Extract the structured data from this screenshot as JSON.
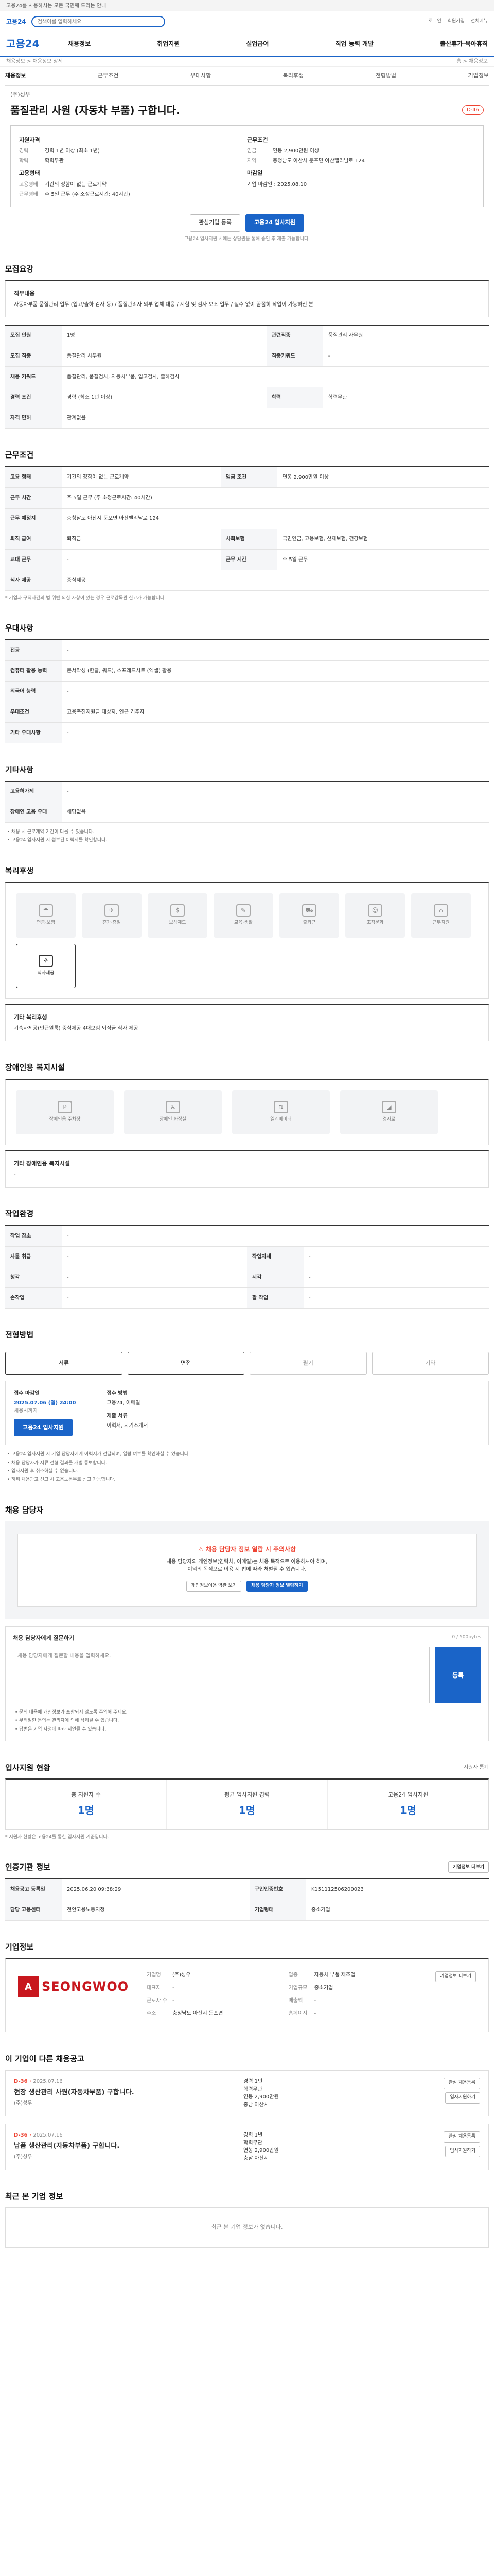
{
  "topbar": {
    "text": "고용24를 사용하시는 모든 국민께 드리는 안내"
  },
  "search": {
    "logo": "고용24",
    "placeholder": "검색어를 입력하세요"
  },
  "top_links": [
    "로그인",
    "회원가입",
    "전체메뉴"
  ],
  "gnb": {
    "brand": "고용24",
    "menu": [
      "채용정보",
      "취업지원",
      "실업급여",
      "직업 능력 개발",
      "출산휴가·육아휴직"
    ]
  },
  "crumb": {
    "left": "채용정보 > 채용정보 상세",
    "right": "홈 > 채용정보"
  },
  "subtabs": [
    "채용정보",
    "근무조건",
    "우대사항",
    "복리후생",
    "전형방법",
    "기업정보"
  ],
  "job": {
    "company": "(주)성우",
    "title": "품질관리 사원 (자동차 부품) 구합니다.",
    "badge": "D-46",
    "qual_title": "지원자격",
    "qual": [
      {
        "k": "경력",
        "v": "경력 1년 이상 (최소 1년)"
      },
      {
        "k": "학력",
        "v": "학력무관"
      }
    ],
    "cond_title": "근무조건",
    "cond": [
      {
        "k": "임금",
        "v": "연봉 2,900만원 이상"
      },
      {
        "k": "지역",
        "v": "충청남도 아산시 둔포면 아산밸리남로 124"
      }
    ],
    "form_title": "고용형태",
    "form": [
      {
        "k": "고용형태",
        "v": "기간의 정함이 없는 근로계약"
      },
      {
        "k": "근무형태",
        "v": "주 5일 근무 (주 소정근로시간: 40시간)"
      }
    ],
    "deadline_title": "마감일",
    "deadline": "기업 마감일 : 2025.08.10"
  },
  "actions": {
    "share": "관심기업 등록",
    "apply": "고용24 입사지원"
  },
  "notice": "고용24 입사지원 시에는 상담원을 통해 승인 후 제출 가능합니다.",
  "sec_job": {
    "title": "모집요강",
    "desc_head": "직무내용",
    "desc": "자동차부품 품질관리 업무 (입고/출하 검사 등) / 품질관리자 외부 업체 대응 / 시험 및 검사 보조 업무 / 실수 없이 꼼꼼히 작업이 가능하신 분",
    "rows": [
      {
        "k": "모집 인원",
        "v": "1명",
        "k2": "관련직종",
        "v2": "품질관리 사무원"
      },
      {
        "k": "모집 직종",
        "v": "품질관리 사무원",
        "k2": "직종키워드",
        "v2": "-"
      },
      {
        "k": "채용 키워드",
        "v": "품질관리, 품질검사, 자동차부품, 입고검사, 출하검사",
        "k2": "",
        "v2": ""
      },
      {
        "k": "경력 조건",
        "v": "경력 (최소 1년 이상)",
        "k2": "학력",
        "v2": "학력무관"
      },
      {
        "k": "자격 면허",
        "v": "관계없음",
        "k2": "",
        "v2": ""
      }
    ]
  },
  "sec_cond": {
    "title": "근무조건",
    "rows": [
      {
        "k": "고용 형태",
        "v": "기간의 정함이 없는 근로계약",
        "k2": "임금 조건",
        "v2": "연봉 2,900만원 이상"
      },
      {
        "k": "근무 시간",
        "v": "주 5일 근무 (주 소정근로시간: 40시간)",
        "k2": "",
        "v2": ""
      },
      {
        "k": "근무 예정지",
        "v": "충청남도 아산시 둔포면 아산밸리남로 124",
        "k2": "",
        "v2": ""
      },
      {
        "k": "퇴직 급여",
        "v": "퇴직금",
        "k2": "사회보험",
        "v2": "국민연금, 고용보험, 산재보험, 건강보험"
      },
      {
        "k": "교대 근무",
        "v": "-",
        "k2": "근무 시간",
        "v2": "주 5일 근무"
      },
      {
        "k": "식사 제공",
        "v": "중식제공",
        "k2": "",
        "v2": ""
      }
    ],
    "note": "* 기업과 구직자간의 법 위반 의심 사항이 있는 경우 근로감독관 신고가 가능합니다."
  },
  "sec_pref": {
    "title": "우대사항",
    "rows": [
      {
        "k": "전공",
        "v": "-"
      },
      {
        "k": "컴퓨터 활용 능력",
        "v": "문서작성 (한글, 워드), 스프레드시트 (엑셀) 활용"
      },
      {
        "k": "외국어 능력",
        "v": "-"
      },
      {
        "k": "우대조건",
        "v": "고용촉진지원금 대상자, 인근 거주자"
      },
      {
        "k": "기타 우대사항",
        "v": "-"
      }
    ]
  },
  "sec_etc": {
    "title": "기타사항",
    "rows": [
      {
        "k": "고용허가제",
        "v": "-"
      },
      {
        "k": "장애인 고용 우대",
        "v": "해당없음"
      }
    ],
    "bullets": [
      "채용 시 근로계약 기간이 다를 수 있습니다.",
      "고용24 입사지원 시 첨부된 이력서를 확인합니다."
    ]
  },
  "sec_welfare": {
    "title": "복리후생",
    "icons": [
      {
        "n": "연금·보험",
        "g": "☂",
        "on": false
      },
      {
        "n": "휴가·휴일",
        "g": "✈",
        "on": false
      },
      {
        "n": "보상제도",
        "g": "$",
        "on": false
      },
      {
        "n": "교육·생활",
        "g": "✎",
        "on": false
      },
      {
        "n": "출퇴근",
        "g": "⛟",
        "on": false
      },
      {
        "n": "조직문화",
        "g": "☺",
        "on": false
      },
      {
        "n": "근무지원",
        "g": "⌂",
        "on": false
      },
      {
        "n": "식사제공",
        "g": "⚘",
        "on": true
      }
    ],
    "detail_head": "기타 복리후생",
    "detail": "기숙사제공(인근원룸) 중식제공 4대보험 퇴직금 식사 제공"
  },
  "sec_disab": {
    "title": "장애인용 복지시설",
    "icons": [
      {
        "n": "장애인용 주차장",
        "g": "P"
      },
      {
        "n": "장애인 화장실",
        "g": "♿"
      },
      {
        "n": "엘리베이터",
        "g": "⇅"
      },
      {
        "n": "경사로",
        "g": "◢"
      }
    ],
    "detail_head": "기타 장애인용 복지시설",
    "detail": "-"
  },
  "sec_env": {
    "title": "작업환경",
    "rows": [
      {
        "k": "작업 장소",
        "v": "-",
        "k2": "",
        "v2": ""
      },
      {
        "k": "사물 취급",
        "v": "-",
        "k2": "작업자세",
        "v2": "-"
      },
      {
        "k": "청각",
        "v": "-",
        "k2": "시각",
        "v2": "-"
      },
      {
        "k": "손작업",
        "v": "-",
        "k2": "팔 작업",
        "v2": "-"
      }
    ]
  },
  "sec_method": {
    "title": "전형방법",
    "methods": [
      {
        "n": "서류",
        "on": true
      },
      {
        "n": "면접",
        "on": true
      },
      {
        "n": "필기",
        "on": false
      },
      {
        "n": "기타",
        "on": false
      }
    ],
    "apply": {
      "deadline_lbl": "접수 마감일",
      "deadline": "2025.07.06 (일) 24:00",
      "deadline_sub": "채용시까지",
      "apply_btn": "고용24 입사지원",
      "method_lbl": "접수 방법",
      "method": "고용24, 이메일",
      "docs_lbl": "제출 서류",
      "docs": "이력서, 자기소개서"
    },
    "bullets": [
      "고용24 입사지원 시 기업 담당자에게 이력서가 전달되며, 열람 여부를 확인하실 수 있습니다.",
      "채용 담당자가 서류 전형 결과를 개별 통보합니다.",
      "입사지원 후 취소하실 수 없습니다.",
      "허위 채용광고 신고 시 고용노동부로 신고 가능합니다."
    ]
  },
  "sec_contact": {
    "title": "채용 담당자",
    "warn": "채용 담당자 정보 열람 시 주의사항",
    "lines": [
      "채용 담당자의 개인정보(연락처, 이메일)는 채용 목적으로 이용하셔야 하며,",
      "이외의 목적으로 이용 시 법에 따라 처벌될 수 있습니다."
    ],
    "btn_agree": "개인정보이용 약관 보기",
    "btn_view": "채용 담당자 정보 열람하기",
    "qa_title": "채용 담당자에게 질문하기",
    "qa_placeholder": "채용 담당자에게 질문할 내용을 입력하세요.",
    "qa_limit": "0 / 500bytes",
    "qa_send": "등록",
    "qa_notes": [
      "문의 내용에 개인정보가 포함되지 않도록 주의해 주세요.",
      "부적절한 문의는 관리자에 의해 삭제될 수 있습니다.",
      "답변은 기업 사정에 따라 지연될 수 있습니다."
    ]
  },
  "sec_stats": {
    "title": "입사지원 현황",
    "right": "지원자 통계",
    "cells": [
      {
        "lab": "총 지원자 수",
        "num": "1명"
      },
      {
        "lab": "평균 입사지원 경력",
        "num": "1명"
      },
      {
        "lab": "고용24 입사지원",
        "num": "1명"
      }
    ],
    "note": "* 지원자 현황은 고용24를 통한 입사지원 기준입니다."
  },
  "sec_info": {
    "title": "인증기관 정보",
    "right": "기업정보 더보기",
    "rows": [
      {
        "k": "채용공고 등록일",
        "v": "2025.06.20 09:38:29",
        "k2": "구인인증번호",
        "v2": "K151112506200023"
      },
      {
        "k": "담당 고용센터",
        "v": "천안고용노동지청",
        "k2": "기업형태",
        "v2": "중소기업"
      }
    ]
  },
  "sec_company": {
    "title": "기업정보",
    "logo_mark": "A",
    "logo_word": "SEONGWOO",
    "more": "기업정보 더보기",
    "info": [
      {
        "k": "기업명",
        "v": "(주)성우"
      },
      {
        "k": "업종",
        "v": "자동차 부품 제조업"
      },
      {
        "k": "대표자",
        "v": "-"
      },
      {
        "k": "기업규모",
        "v": "중소기업"
      },
      {
        "k": "근로자 수",
        "v": "-"
      },
      {
        "k": "매출액",
        "v": "-"
      },
      {
        "k": "주소",
        "v": "충청남도 아산시 둔포면"
      },
      {
        "k": "홈페이지",
        "v": "-"
      }
    ]
  },
  "sec_related": {
    "title": "이 기업이 다른 채용공고",
    "cards": [
      {
        "dday": "D-36",
        "date": "2025.07.16",
        "title": "현장 생산관리 사원(자동차부품) 구합니다.",
        "comp": "(주)성우",
        "m1": "경력 1년",
        "m2": "학력무관",
        "m3": "연봉 2,900만원",
        "m4": "충남 아산시",
        "b1": "관심 채용등록",
        "b2": "입사지원하기"
      },
      {
        "dday": "D-36",
        "date": "2025.07.16",
        "title": "남품 생산관리(자동차부품) 구합니다.",
        "comp": "(주)성우",
        "m1": "경력 1년",
        "m2": "학력무관",
        "m3": "연봉 2,900만원",
        "m4": "충남 아산시",
        "b1": "관심 채용등록",
        "b2": "입사지원하기"
      }
    ]
  },
  "sec_recent": {
    "title": "최근 본 기업 정보",
    "empty": "최근 본 기업 정보가 없습니다."
  }
}
